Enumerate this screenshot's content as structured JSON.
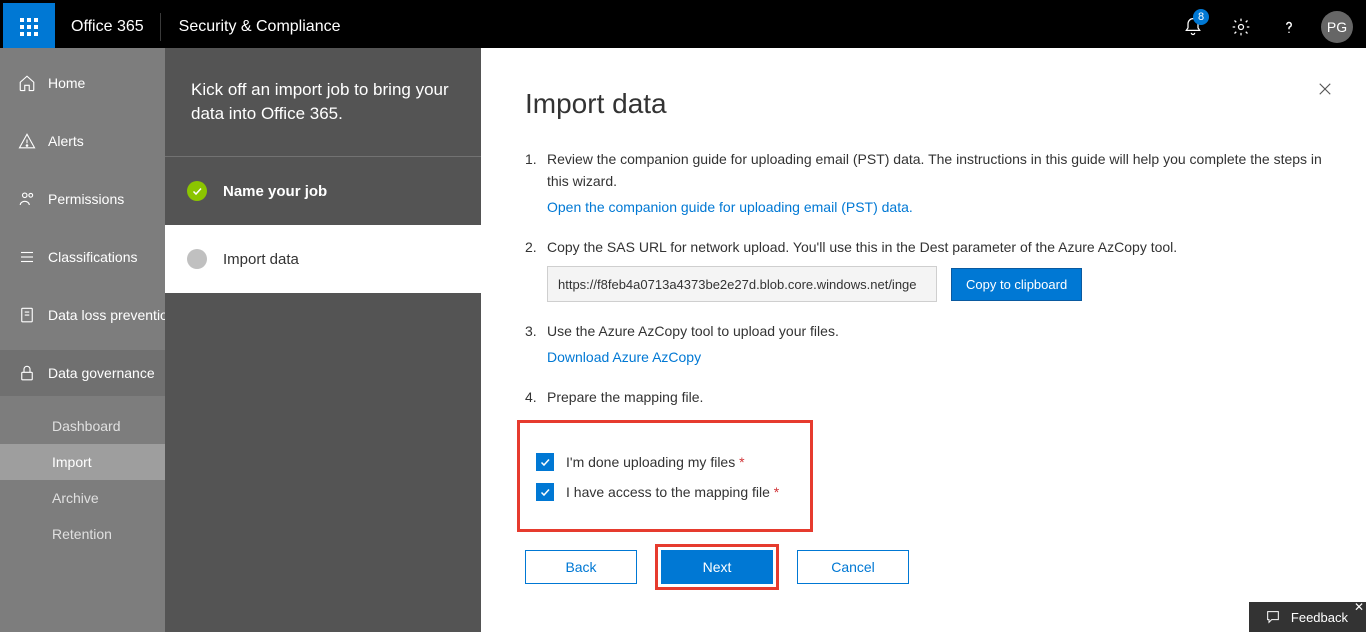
{
  "header": {
    "product": "Office 365",
    "suite": "Security & Compliance",
    "notification_count": "8",
    "avatar": "PG"
  },
  "nav": {
    "items": [
      {
        "icon": "home-icon",
        "label": "Home"
      },
      {
        "icon": "alert-icon",
        "label": "Alerts"
      },
      {
        "icon": "permissions-icon",
        "label": "Permissions"
      },
      {
        "icon": "classifications-icon",
        "label": "Classifications"
      },
      {
        "icon": "dlp-icon",
        "label": "Data loss prevention"
      },
      {
        "icon": "lock-icon",
        "label": "Data governance"
      }
    ],
    "subitems": [
      "Dashboard",
      "Import",
      "Archive",
      "Retention"
    ]
  },
  "wizard": {
    "intro": "Kick off an import job to bring your data into Office 365.",
    "steps": [
      {
        "label": "Name your job",
        "state": "done"
      },
      {
        "label": "Import data",
        "state": "current"
      }
    ]
  },
  "page": {
    "title": "Import data",
    "step1_text": "Review the companion guide for uploading email (PST) data. The instructions in this guide will help you complete the steps in this wizard.",
    "step1_link": "Open the companion guide for uploading email (PST) data.",
    "step2_text": "Copy the SAS URL for network upload. You'll use this in the Dest parameter of the Azure AzCopy tool.",
    "sas_url": "https://f8feb4a0713a4373be2e27d.blob.core.windows.net/inge",
    "copy_label": "Copy to clipboard",
    "step3_text": "Use the Azure AzCopy tool to upload your files.",
    "step3_link": "Download Azure AzCopy",
    "step4_text": "Prepare the mapping file.",
    "cb1": "I'm done uploading my files",
    "cb2": "I have access to the mapping file",
    "buttons": {
      "back": "Back",
      "next": "Next",
      "cancel": "Cancel"
    }
  },
  "feedback": "Feedback"
}
